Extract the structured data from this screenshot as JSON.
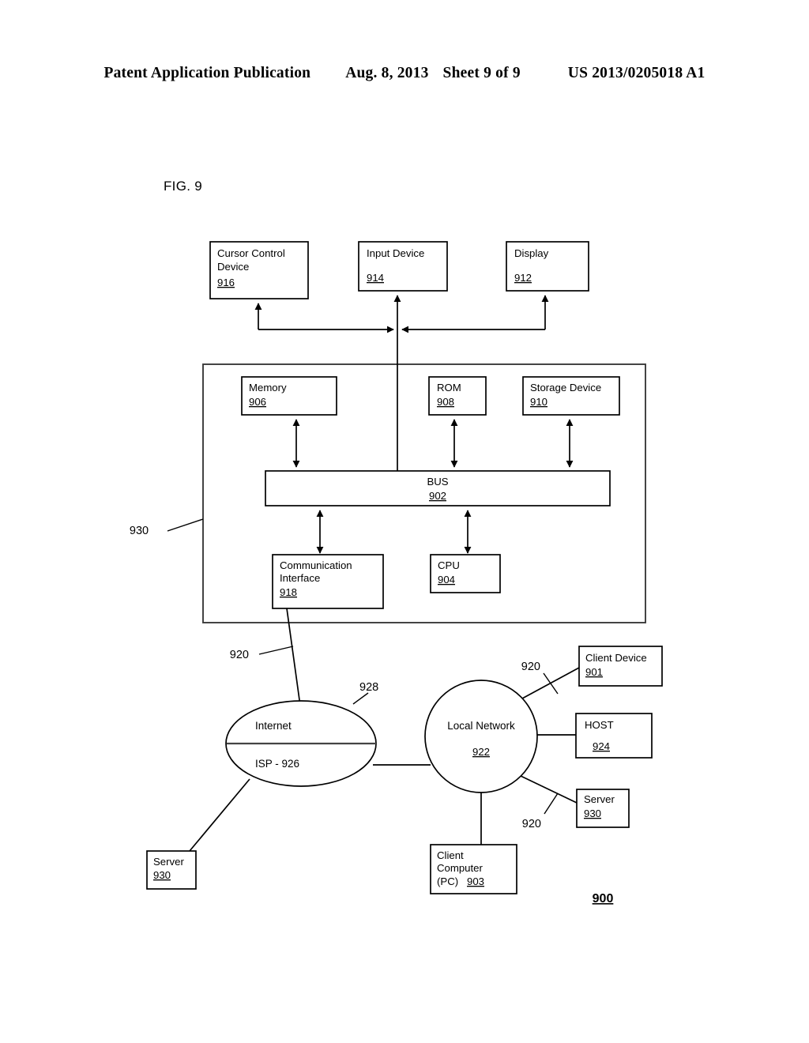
{
  "header": {
    "publication": "Patent Application Publication",
    "date": "Aug. 8, 2013",
    "sheet": "Sheet 9 of 9",
    "number": "US 2013/0205018 A1"
  },
  "figure": {
    "label": "FIG. 9",
    "total_ref": "900"
  },
  "diagram": {
    "boxes": {
      "cursor_control": {
        "line1": "Cursor Control",
        "line2": "Device",
        "ref": "916"
      },
      "input_device": {
        "line1": "Input Device",
        "line2": "",
        "ref": "914"
      },
      "display": {
        "line1": "Display",
        "line2": "",
        "ref": "912"
      },
      "memory": {
        "line1": "Memory",
        "ref": "906"
      },
      "rom": {
        "line1": "ROM",
        "ref": "908"
      },
      "storage": {
        "line1": "Storage Device",
        "ref": "910"
      },
      "bus": {
        "line1": "BUS",
        "ref": "902"
      },
      "comm_interface": {
        "line1": "Communication",
        "line2": "Interface",
        "ref": "918"
      },
      "cpu": {
        "line1": "CPU",
        "ref": "904"
      },
      "client_device": {
        "line1": "Client Device",
        "ref": "901"
      },
      "host": {
        "line1": "HOST",
        "ref": "924"
      },
      "server_right": {
        "line1": "Server",
        "ref": "930"
      },
      "server_left": {
        "line1": "Server",
        "ref": "930"
      },
      "client_computer": {
        "line1": "Client",
        "line2": "Computer",
        "line3": "(PC)",
        "ref": "903"
      }
    },
    "nodes": {
      "internet": {
        "label": "Internet",
        "isp": "ISP - 926"
      },
      "local_network": {
        "label": "Local Network",
        "ref": "922"
      }
    },
    "leaders": {
      "computer_system": "930",
      "link_comm": "920",
      "link_isp": "928",
      "link_client_device": "920",
      "link_server": "920"
    }
  }
}
